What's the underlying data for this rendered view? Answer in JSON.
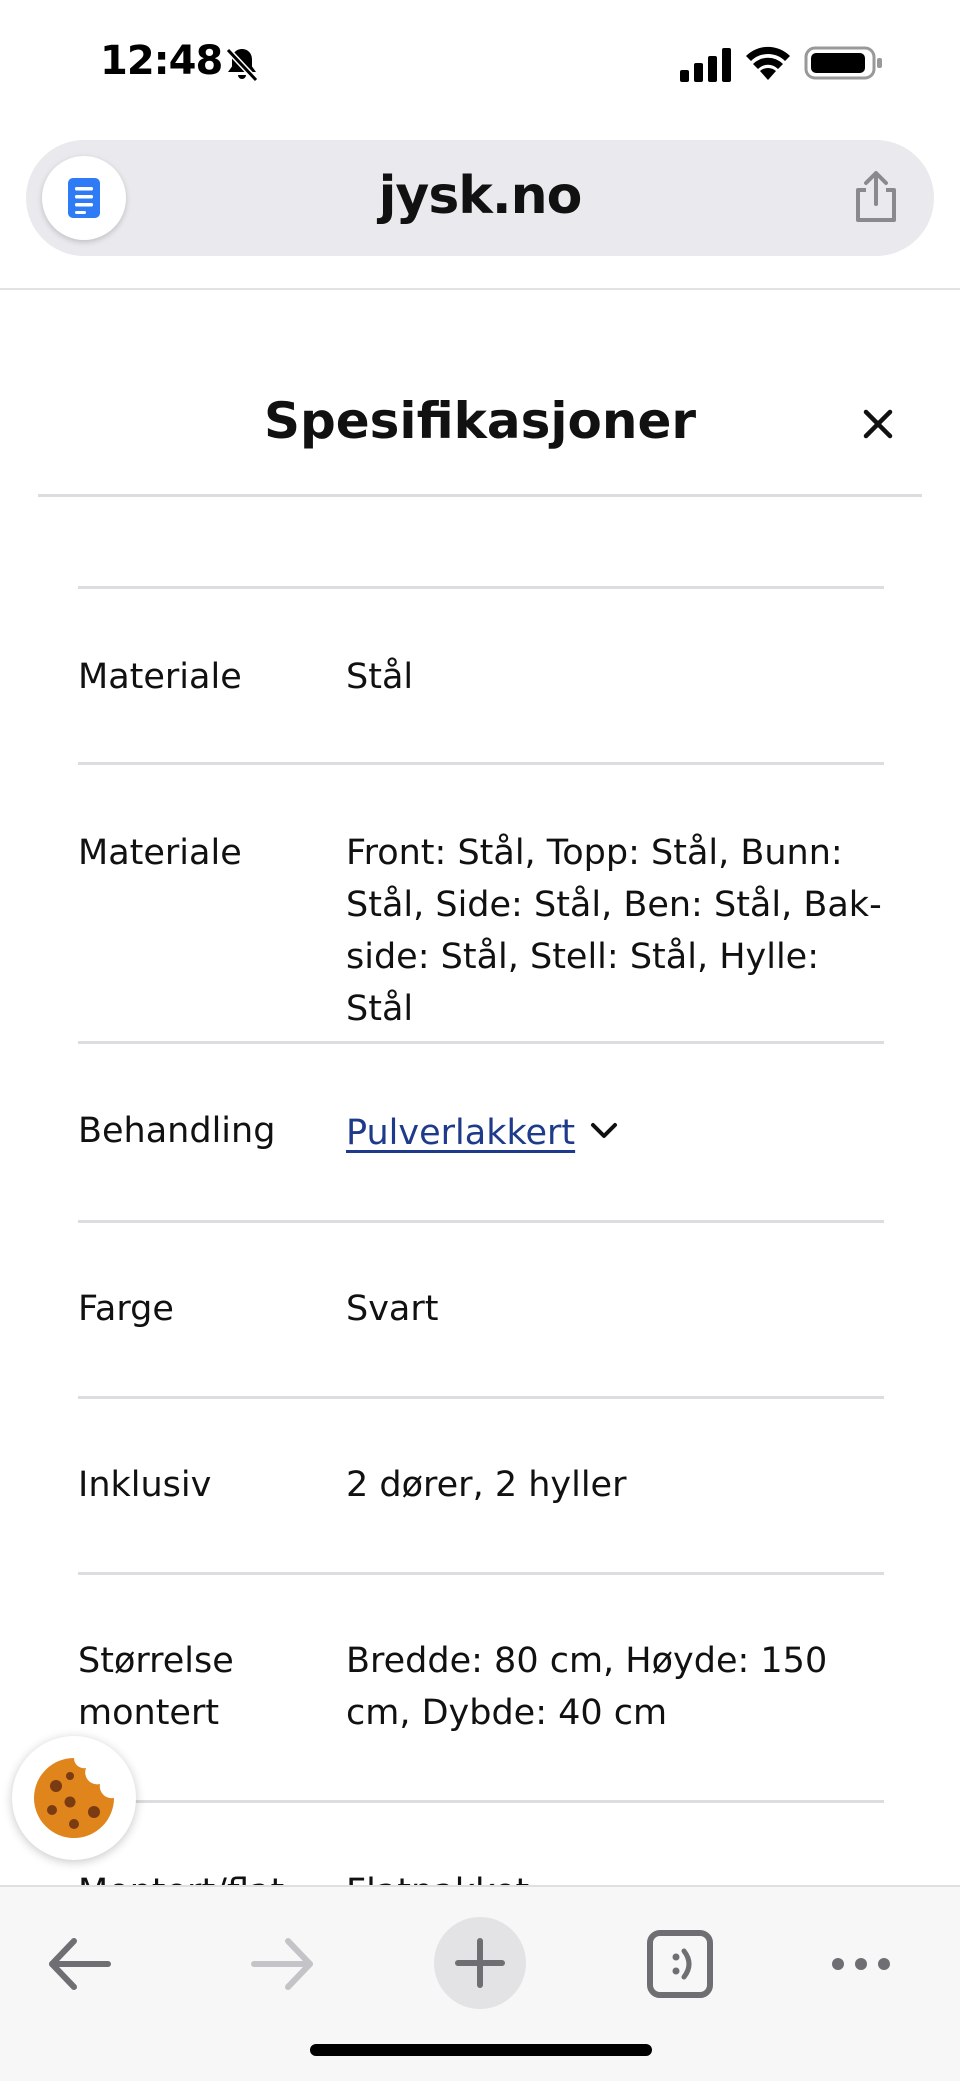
{
  "status_bar": {
    "time": "12:48",
    "icons": [
      "bell-slash-icon",
      "signal-icon",
      "wifi-icon",
      "battery-icon"
    ]
  },
  "browser": {
    "url": "jysk.no",
    "icons": [
      "reader-icon",
      "share-icon"
    ]
  },
  "panel": {
    "title": "Spesifikasjoner",
    "rows": [
      {
        "label": "Materiale",
        "value": "Stål"
      },
      {
        "label": "Materiale",
        "value": "Front: Stål, Topp: Stål, Bunn: Stål, Side: Stål, Ben: Stål, Bak­side: Stål, Stell: Stål, Hylle: Stål"
      },
      {
        "label": "Behandling",
        "value": "Pulverlakkert"
      },
      {
        "label": "Farge",
        "value": "Svart"
      },
      {
        "label": "Inklusiv",
        "value": "2 dører, 2 hyller"
      },
      {
        "label": "Størrelse mon­tert",
        "value": "Bredde: 80 cm, Høyde: 150 cm, Dybde: 40 cm"
      },
      {
        "label": "Montert/flat",
        "value": "Flatpakket"
      }
    ]
  },
  "colors": {
    "link": "#1e3a8a",
    "divider": "#dcdde0",
    "address_bar": "#e9e9ee",
    "reader_blue": "#2f7bf5",
    "cookie": "#e0841c"
  },
  "toolbar": {
    "icons": [
      "back-arrow-icon",
      "forward-arrow-icon",
      "plus-icon",
      "tabs-icon",
      "more-icon"
    ]
  }
}
